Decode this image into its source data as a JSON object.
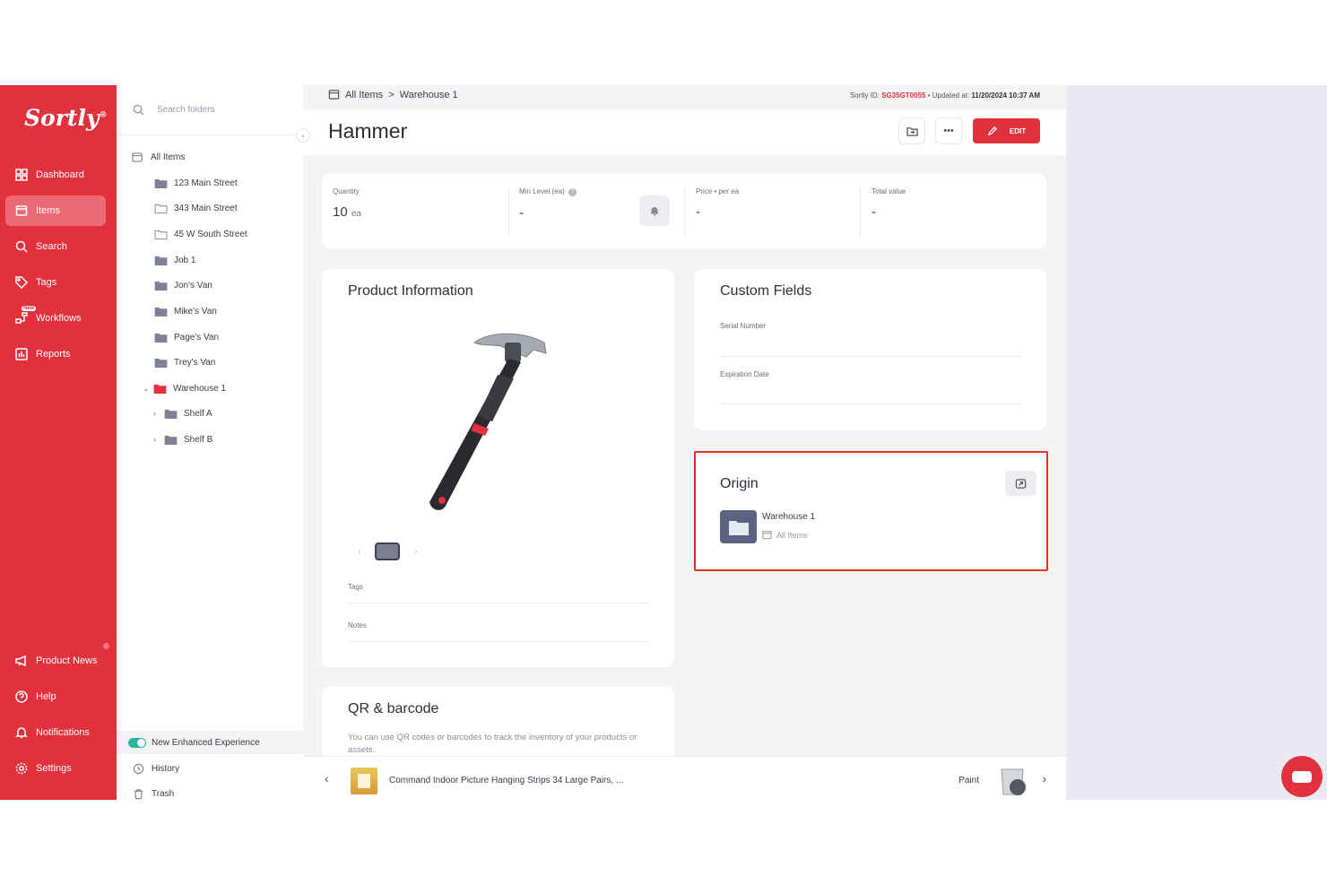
{
  "brand": {
    "logo": "Sortly",
    "accent": "#e0313d"
  },
  "nav": {
    "items": [
      {
        "label": "Dashboard",
        "icon": "dashboard-icon"
      },
      {
        "label": "Items",
        "icon": "items-icon",
        "active": true
      },
      {
        "label": "Search",
        "icon": "search-icon"
      },
      {
        "label": "Tags",
        "icon": "tag-icon"
      },
      {
        "label": "Workflows",
        "icon": "workflows-icon",
        "badge": "New"
      },
      {
        "label": "Reports",
        "icon": "reports-icon"
      }
    ],
    "bottom": [
      {
        "label": "Product News",
        "icon": "megaphone-icon"
      },
      {
        "label": "Help",
        "icon": "help-icon"
      },
      {
        "label": "Notifications",
        "icon": "bell-icon"
      },
      {
        "label": "Settings",
        "icon": "gear-icon"
      }
    ]
  },
  "folders": {
    "search_placeholder": "Search folders",
    "root": "All Items",
    "items": [
      {
        "label": "123 Main Street",
        "filled": true
      },
      {
        "label": "343 Main Street",
        "filled": false
      },
      {
        "label": "45 W South Street",
        "filled": false
      },
      {
        "label": "Job 1",
        "filled": true
      },
      {
        "label": "Jon's Van",
        "filled": true
      },
      {
        "label": "Mike's Van",
        "filled": true
      },
      {
        "label": "Page's Van",
        "filled": true
      },
      {
        "label": "Trey's Van",
        "filled": true
      },
      {
        "label": "Warehouse 1",
        "filled": true,
        "selected": true
      },
      {
        "label": "Shelf A",
        "filled": true
      },
      {
        "label": "Shelf B",
        "filled": true
      }
    ],
    "enhanced_label": "New Enhanced Experience",
    "history_label": "History",
    "trash_label": "Trash"
  },
  "breadcrumb": {
    "root": "All Items",
    "separator": ">",
    "current": "Warehouse 1"
  },
  "meta": {
    "id_label": "Sortly ID:",
    "id_value": "SG35GT0055",
    "updated_label": "• Updated at:",
    "updated_value": "11/20/2024 10:37 AM"
  },
  "item": {
    "title": "Hammer",
    "edit_label": "EDIT",
    "more_label": "•••"
  },
  "stats": {
    "quantity_label": "Quantity",
    "quantity_value": "10",
    "quantity_unit": "ea",
    "min_label": "Min Level (ea)",
    "min_value": "-",
    "price_label": "Price • per ea",
    "price_value": "-",
    "total_label": "Total value",
    "total_value": "-"
  },
  "product": {
    "title": "Product Information",
    "tags_label": "Tags",
    "notes_label": "Notes"
  },
  "custom": {
    "title": "Custom Fields",
    "field1": "Serial Number",
    "field2": "Expiration Date"
  },
  "origin": {
    "title": "Origin",
    "folder": "Warehouse 1",
    "path": "All Items"
  },
  "qr": {
    "title": "QR & barcode",
    "desc": "You can use QR codes or barcodes to track the inventory of your products or assets."
  },
  "footer": {
    "prev_item": "Command Indoor Picture Hanging Strips 34 Large Pairs, ...",
    "next_item": "Paint"
  }
}
